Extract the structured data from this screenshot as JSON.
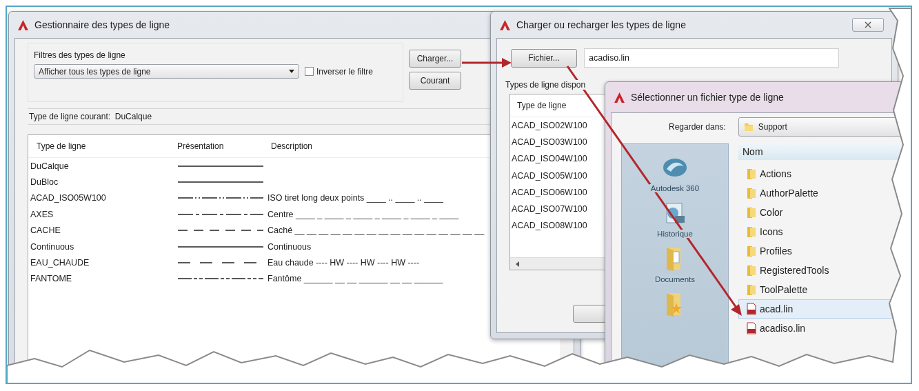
{
  "linetype_manager": {
    "title": "Gestionnaire des types de ligne",
    "filter_label": "Filtres des types de ligne",
    "filter_value": "Afficher tous les types de ligne",
    "invert_filter": {
      "label": "Inverser le filtre",
      "checked": false
    },
    "buttons": [
      "Charger...",
      "Courant"
    ],
    "current_label": "Type de ligne courant:",
    "current_value": "DuCalque",
    "columns": [
      "Type de ligne",
      "Présentation",
      "Description"
    ],
    "rows": [
      {
        "name": "DuCalque",
        "kind": "solid"
      },
      {
        "name": "DuBloc",
        "kind": "solid"
      },
      {
        "name": "ACAD_ISO05W100",
        "kind": "dashdotdot",
        "description": "ISO tiret long deux points ____ .. ____ .. ____"
      },
      {
        "name": "AXES",
        "kind": "center",
        "description": "Centre ____ _ ____ _ ____ _ ____ _ ____ _ ____"
      },
      {
        "name": "CACHE",
        "kind": "hidden",
        "description": "Caché __ __ __ __ __ __ __ __ __ __ __ __ __ __ __ __"
      },
      {
        "name": "Continuous",
        "kind": "solid",
        "description": "Continuous"
      },
      {
        "name": "EAU_CHAUDE",
        "kind": "hotwater",
        "description": "Eau chaude ---- HW ---- HW ---- HW ----"
      },
      {
        "name": "FANTOME",
        "kind": "phantom",
        "description": "Fantôme ______ __ __ ______ __ __ ______"
      }
    ]
  },
  "load_dialog": {
    "title": "Charger ou recharger les types de ligne",
    "file_button": "Fichier...",
    "file_value": "acadiso.lin",
    "list_label": "Types de ligne dispon",
    "column": "Type de ligne",
    "rows": [
      "ACAD_ISO02W100",
      "ACAD_ISO03W100",
      "ACAD_ISO04W100",
      "ACAD_ISO05W100",
      "ACAD_ISO06W100",
      "ACAD_ISO07W100",
      "ACAD_ISO08W100"
    ]
  },
  "file_dialog": {
    "title": "Sélectionner un fichier type de ligne",
    "look_in_label": "Regarder dans:",
    "look_in_value": "Support",
    "places": [
      {
        "kind": "cloud",
        "label": "Autodesk 360"
      },
      {
        "kind": "history",
        "label": "Historique"
      },
      {
        "kind": "documents",
        "label": "Documents"
      },
      {
        "kind": "favorites"
      }
    ],
    "column": "Nom",
    "items": [
      {
        "name": "Actions",
        "kind": "folder",
        "selected": false
      },
      {
        "name": "AuthorPalette",
        "kind": "folder",
        "selected": false
      },
      {
        "name": "Color",
        "kind": "folder",
        "selected": false
      },
      {
        "name": "Icons",
        "kind": "folder",
        "selected": false
      },
      {
        "name": "Profiles",
        "kind": "folder",
        "selected": false
      },
      {
        "name": "RegisteredTools",
        "kind": "folder",
        "selected": false
      },
      {
        "name": "ToolPalette",
        "kind": "folder",
        "selected": false
      },
      {
        "name": "acad.lin",
        "kind": "file",
        "selected": true
      },
      {
        "name": "acadiso.lin",
        "kind": "file",
        "selected": false
      }
    ]
  }
}
